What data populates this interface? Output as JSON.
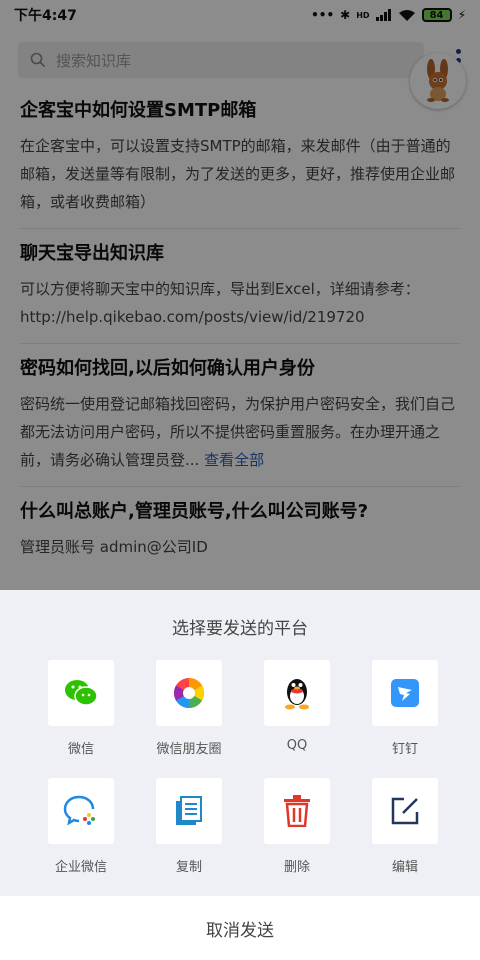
{
  "status_bar": {
    "time": "下午4:47",
    "battery": "84",
    "net": "HD"
  },
  "search": {
    "placeholder": "搜索知识库"
  },
  "articles": [
    {
      "title": "企客宝中如何设置SMTP邮箱",
      "body": "在企客宝中，可以设置支持SMTP的邮箱，来发邮件（由于普通的邮箱，发送量等有限制，为了发送的更多，更好，推荐使用企业邮箱，或者收费邮箱）",
      "more": ""
    },
    {
      "title": "聊天宝导出知识库",
      "body": "可以方便将聊天宝中的知识库，导出到Excel，详细请参考：http://help.qikebao.com/posts/view/id/219720",
      "more": ""
    },
    {
      "title": "密码如何找回,以后如何确认用户身份",
      "body": "密码统一使用登记邮箱找回密码，为保护用户密码安全，我们自己都无法访问用户密码，所以不提供密码重置服务。在办理开通之前，请务必确认管理员登...",
      "more": "查看全部"
    },
    {
      "title": "什么叫总账户,管理员账号,什么叫公司账号?",
      "body": "管理员账号 admin@公司ID",
      "more": ""
    }
  ],
  "share_sheet": {
    "title": "选择要发送的平台",
    "platforms": [
      {
        "label": "微信",
        "icon": "wechat-icon"
      },
      {
        "label": "微信朋友圈",
        "icon": "moments-icon"
      },
      {
        "label": "QQ",
        "icon": "qq-icon"
      },
      {
        "label": "钉钉",
        "icon": "dingtalk-icon"
      },
      {
        "label": "企业微信",
        "icon": "wecom-icon"
      },
      {
        "label": "复制",
        "icon": "copy-icon"
      },
      {
        "label": "删除",
        "icon": "delete-icon"
      },
      {
        "label": "编辑",
        "icon": "edit-icon"
      }
    ],
    "cancel_label": "取消发送"
  },
  "colors": {
    "link": "#2b5db8",
    "sheet_bg": "#eef0f5",
    "wechat": "#2dc100",
    "dingtalk": "#3296fa",
    "delete": "#e0372a",
    "copy": "#1e88c8"
  }
}
